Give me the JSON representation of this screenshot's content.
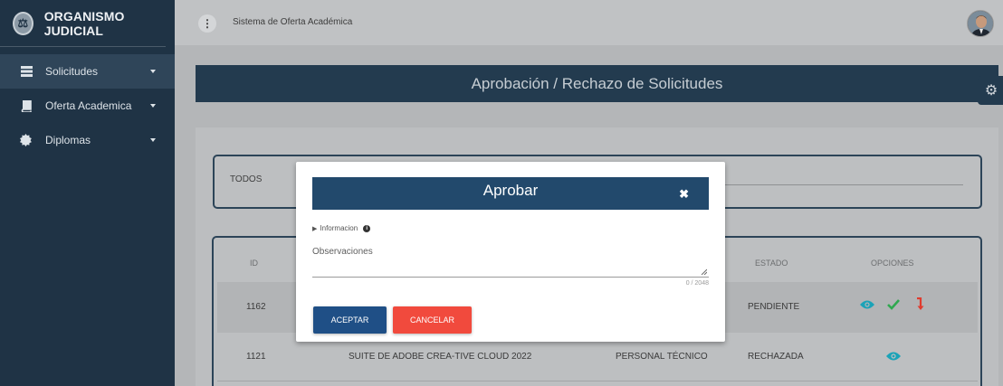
{
  "brand": {
    "name": "ORGANISMO JUDICIAL"
  },
  "sidebar": {
    "items": [
      {
        "label": "Solicitudes",
        "icon": "list-icon"
      },
      {
        "label": "Oferta Academica",
        "icon": "book-icon"
      },
      {
        "label": "Diplomas",
        "icon": "badge-icon"
      }
    ]
  },
  "topbar": {
    "app_name": "Sistema de Oferta Académica",
    "menu_glyph": "⋮"
  },
  "page": {
    "title": "Aprobación / Rechazo de Solicitudes"
  },
  "filter": {
    "label": "TODOS"
  },
  "table": {
    "headers": {
      "id": "ID",
      "estado": "ESTADO",
      "opciones": "OPCIONES"
    },
    "rows": [
      {
        "id": "1162",
        "curso": "",
        "personal": "",
        "estado": "PENDIENTE"
      },
      {
        "id": "1121",
        "curso": "SUITE DE ADOBE CREA-TIVE CLOUD 2022",
        "personal": "PERSONAL TÉCNICO",
        "estado": "RECHAZADA"
      }
    ]
  },
  "modal": {
    "title": "Aprobar",
    "close_glyph": "✖",
    "info_label": "Informacion",
    "observaciones_label": "Observaciones",
    "counter": "0 / 2048",
    "accept_label": "ACEPTAR",
    "cancel_label": "CANCELAR"
  },
  "colors": {
    "sidebar": "#1f3345",
    "header": "#233b4f",
    "modal_header": "#22496c",
    "accept": "#1f4f86",
    "cancel": "#f14a3d",
    "view_icon": "#1aa3b8",
    "approve_icon": "#2fa84f",
    "reject_icon": "#e03b2e"
  }
}
